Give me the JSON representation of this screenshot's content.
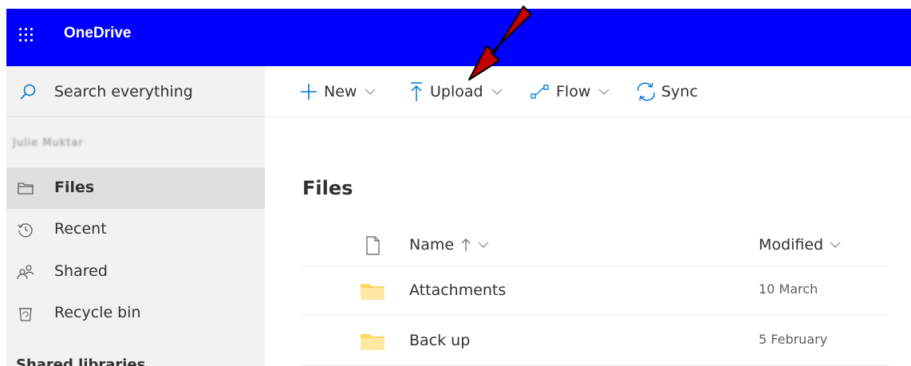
{
  "header": {
    "app_title": "OneDrive"
  },
  "sidebar": {
    "search_label": "Search everything",
    "user_name": "Julie Muktar",
    "items": [
      {
        "label": "Files",
        "icon": "folder-icon",
        "active": true
      },
      {
        "label": "Recent",
        "icon": "history-icon"
      },
      {
        "label": "Shared",
        "icon": "people-icon"
      },
      {
        "label": "Recycle bin",
        "icon": "recycle-bin-icon"
      }
    ],
    "section_label": "Shared libraries"
  },
  "commandbar": {
    "new_label": "New",
    "upload_label": "Upload",
    "flow_label": "Flow",
    "sync_label": "Sync"
  },
  "main": {
    "title": "Files",
    "columns": {
      "name": "Name",
      "modified": "Modified"
    },
    "rows": [
      {
        "name": "Attachments",
        "modified": "10 March"
      },
      {
        "name": "Back up",
        "modified": "5 February"
      }
    ]
  },
  "colors": {
    "topbar": "#0000ff",
    "accent": "#0078d4",
    "arrow": "#c00000",
    "folder": "#ffd75e"
  }
}
